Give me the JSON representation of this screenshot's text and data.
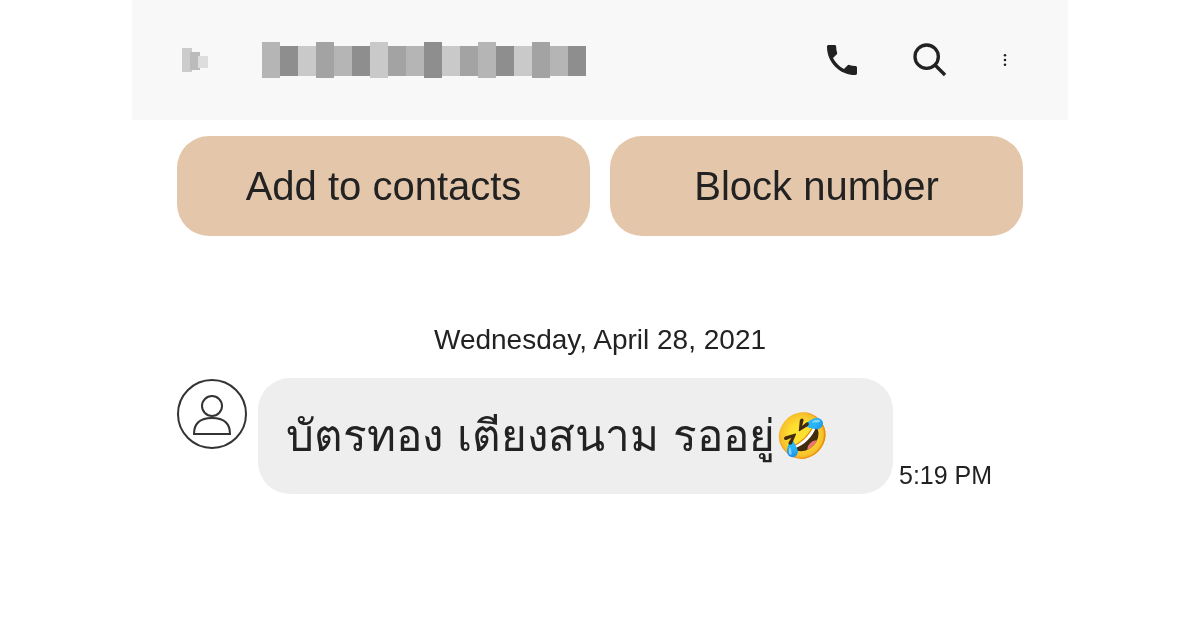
{
  "header": {
    "actions": [
      {
        "kind": "call"
      },
      {
        "kind": "search"
      },
      {
        "kind": "more"
      }
    ]
  },
  "buttons": [
    "Add to contacts",
    "Block number"
  ],
  "date": "Wednesday, April 28, 2021",
  "messages": [
    {
      "text": "บัตรทอง เตียงสนาม รออยู่🤣",
      "time": "5:19 PM"
    }
  ]
}
